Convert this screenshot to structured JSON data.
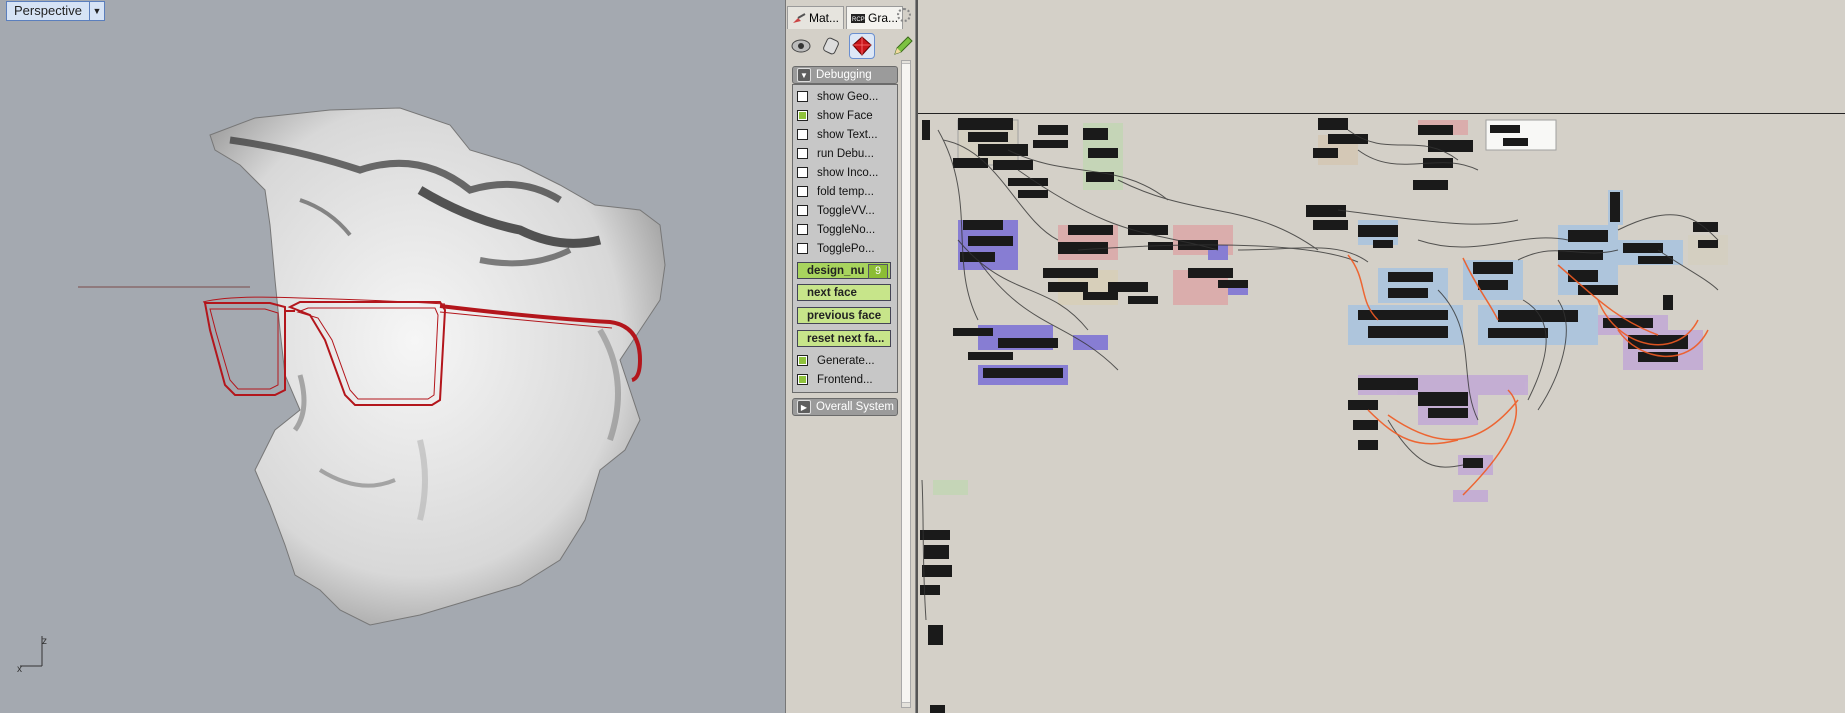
{
  "viewport": {
    "title": "Perspective",
    "dropdown_icon": "triangle-down-icon",
    "axis_labels": {
      "z": "z",
      "x": "x"
    },
    "colors": {
      "background": "#a4a9b0",
      "glasses": "#b3161c",
      "head": "#e8e8e8"
    }
  },
  "panel": {
    "tabs": [
      {
        "label": "Mat...",
        "icon": "brush-icon"
      },
      {
        "label": "Gra...",
        "icon": "rcp-icon",
        "badge": "RCP"
      }
    ],
    "toolbar": {
      "buttons": [
        "eye-icon",
        "eraser-icon",
        "gem-icon",
        "pencil-icon"
      ],
      "active_index": 2
    },
    "groups": {
      "debugging": {
        "label": "Debugging",
        "checkboxes": [
          {
            "label": "show Geo...",
            "checked": false
          },
          {
            "label": "show Face",
            "checked": true
          },
          {
            "label": "show Text...",
            "checked": false
          },
          {
            "label": "run Debu...",
            "checked": false
          },
          {
            "label": "show Inco...",
            "checked": false
          },
          {
            "label": "fold temp...",
            "checked": false
          },
          {
            "label": "ToggleVV...",
            "checked": false
          },
          {
            "label": "ToggleNo...",
            "checked": false
          },
          {
            "label": "TogglePo...",
            "checked": false
          }
        ],
        "slider": {
          "label": "design_nu",
          "value": "9"
        },
        "buttons": [
          "next face",
          "previous face",
          "reset next fa..."
        ],
        "checkboxes2": [
          {
            "label": "Generate...",
            "checked": true
          },
          {
            "label": "Frontend...",
            "checked": true
          }
        ]
      },
      "overall": {
        "label": "Overall System"
      }
    }
  },
  "canvas": {
    "colors": {
      "background": "#d4d0c8",
      "wire": "#333333",
      "wire_highlight": "#f05a22",
      "group_blue": "#a8c4e0",
      "group_purple": "#7a6fd6",
      "group_red": "#dca8a8",
      "group_green": "#c3d6b5",
      "group_violet": "#c2a9d6"
    }
  }
}
